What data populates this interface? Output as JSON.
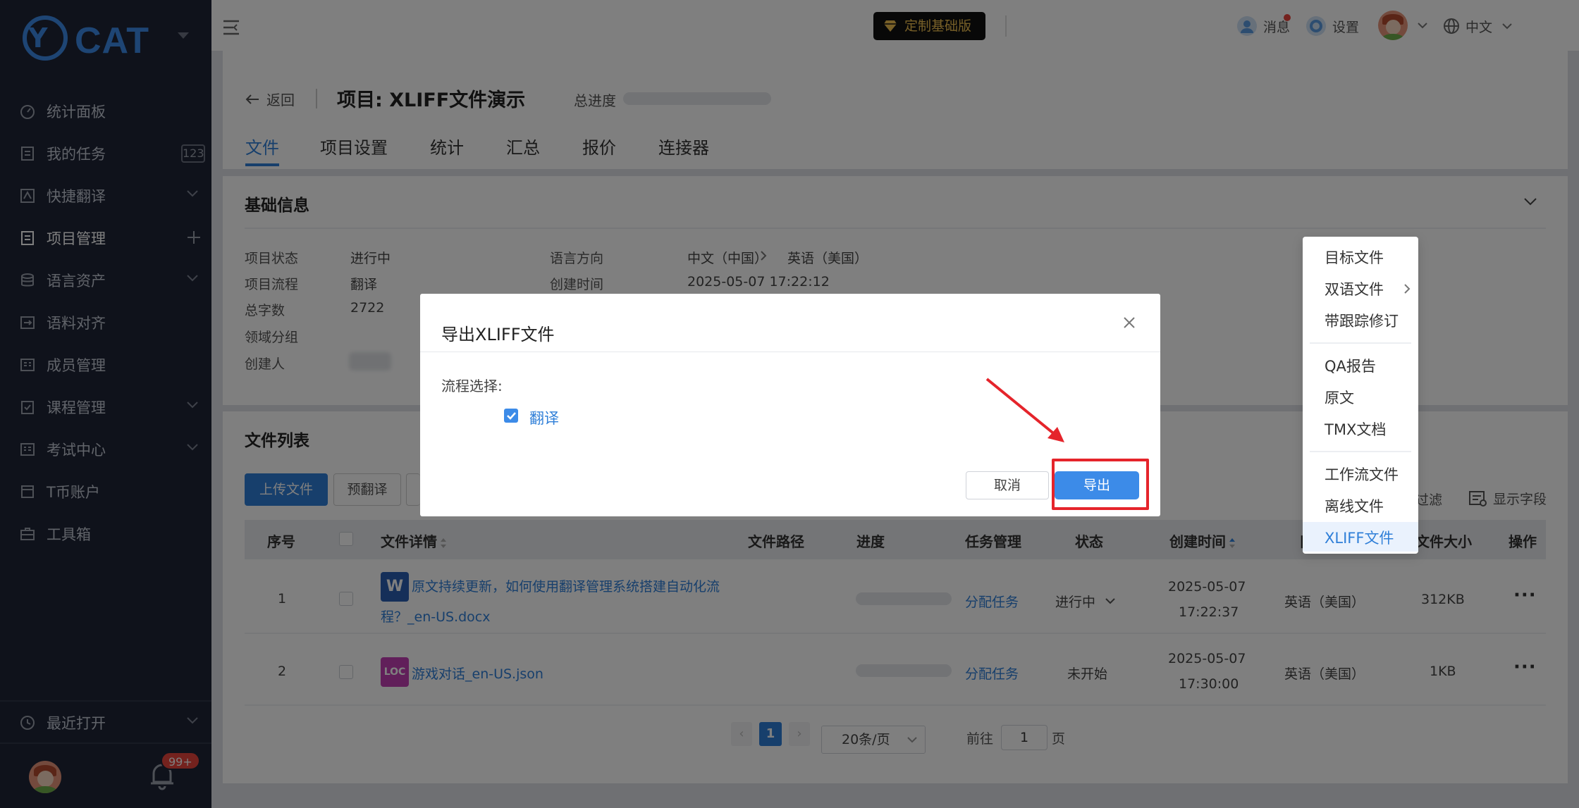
{
  "sidebar": {
    "logo": {
      "mark": "Y",
      "text": "CAT"
    },
    "items": [
      {
        "label": "统计面板",
        "icon": "dashboard-icon"
      },
      {
        "label": "我的任务",
        "icon": "task-icon",
        "badge": "123"
      },
      {
        "label": "快捷翻译",
        "icon": "translate-icon"
      },
      {
        "label": "项目管理",
        "icon": "project-icon"
      },
      {
        "label": "语言资产",
        "icon": "database-icon"
      },
      {
        "label": "语料对齐",
        "icon": "align-icon"
      },
      {
        "label": "成员管理",
        "icon": "members-icon"
      },
      {
        "label": "课程管理",
        "icon": "course-icon"
      },
      {
        "label": "考试中心",
        "icon": "exam-icon"
      },
      {
        "label": "T币账户",
        "icon": "wallet-icon"
      },
      {
        "label": "工具箱",
        "icon": "toolbox-icon"
      }
    ],
    "recent": "最近打开",
    "notif_badge": "99+"
  },
  "topbar": {
    "edition": "定制基础版",
    "messages": "消息",
    "settings": "设置",
    "language": "中文"
  },
  "header": {
    "back": "返回",
    "title": "项目: XLIFF文件演示",
    "progress_label": "总进度",
    "tabs": [
      "文件",
      "项目设置",
      "统计",
      "汇总",
      "报价",
      "连接器"
    ]
  },
  "info": {
    "title": "基础信息",
    "status_label": "项目状态",
    "status": "进行中",
    "flow_label": "项目流程",
    "flow": "翻译",
    "words_label": "总字数",
    "words": "2722",
    "domain_label": "领域分组",
    "creator_label": "创建人",
    "direction_label": "语言方向",
    "source_lang": "中文（中国）",
    "target_lang": "英语（美国）",
    "created_label": "创建时间",
    "created": "2025-05-07 17:22:12"
  },
  "files": {
    "title": "文件列表",
    "upload": "上传文件",
    "pretranslate": "预翻译",
    "filter": "过滤",
    "show_fields": "显示字段",
    "columns": [
      "序号",
      "文件详情",
      "文件路径",
      "进度",
      "任务管理",
      "状态",
      "创建时间",
      "目",
      "文件大小",
      "操作"
    ],
    "rows": [
      {
        "no": "1",
        "name_line1": "原文持续更新，如何使用翻译管理系统搭建自动化流",
        "name_line2": "程？_en-US.docx",
        "icon": "W",
        "task": "分配任务",
        "status": "进行中",
        "date": "2025-05-07",
        "time": "17:22:37",
        "target": "英语（美国）",
        "size": "312KB"
      },
      {
        "no": "2",
        "name_line1": "游戏对话_en-US.json",
        "name_line2": "",
        "icon": "LOC",
        "task": "分配任务",
        "status": "未开始",
        "date": "2025-05-07",
        "time": "17:30:00",
        "target": "英语（美国）",
        "size": "1KB"
      }
    ]
  },
  "pagination": {
    "current": "1",
    "page_size": "20条/页",
    "goto": "前往",
    "goto_value": "1",
    "page": "页"
  },
  "dropdown": [
    "目标文件",
    "双语文件",
    "带跟踪修订",
    "QA报告",
    "原文",
    "TMX文档",
    "工作流文件",
    "离线文件",
    "XLIFF文件"
  ],
  "modal": {
    "title": "导出XLIFF文件",
    "flow_label": "流程选择:",
    "option": "翻译",
    "option_checked": true,
    "cancel": "取消",
    "export": "导出"
  },
  "colors": {
    "accent": "#2f7fd8",
    "sidebar": "#1f2537",
    "highlight": "#e5242b"
  }
}
